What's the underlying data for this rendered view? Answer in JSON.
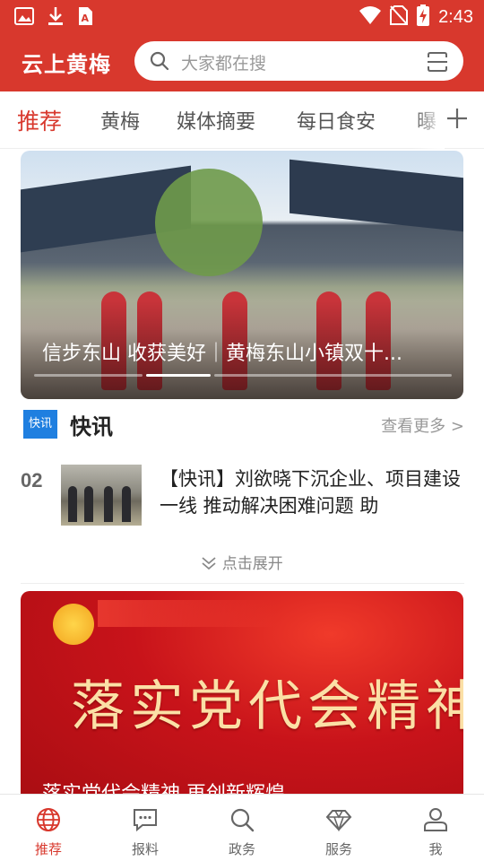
{
  "status_bar": {
    "time": "2:43",
    "left_icons": [
      "image-icon",
      "download-icon",
      "a-icon"
    ],
    "right_icons": [
      "wifi-icon",
      "no-sim-icon",
      "battery-charging-icon"
    ]
  },
  "header": {
    "app_title": "云上黄梅",
    "search_placeholder": "大家都在搜",
    "brand_color": "#d8382d"
  },
  "tabs": {
    "items": [
      {
        "label": "推荐",
        "active": true
      },
      {
        "label": "黄梅",
        "active": false
      },
      {
        "label": "媒体摘要",
        "active": false
      },
      {
        "label": "每日食安",
        "active": false
      },
      {
        "label": "曝",
        "active": false
      }
    ],
    "add_icon": "plus-icon"
  },
  "hero": {
    "caption": "信步东山 收获美好｜黄梅东山小镇双十...",
    "slide_count": 4,
    "active_slide": 2
  },
  "flash": {
    "badge": "快讯",
    "title": "快讯",
    "more": "查看更多 >",
    "item": {
      "number": "02",
      "text": "【快讯】刘欲晓下沉企业、项目建设一线  推动解决困难问题 助"
    },
    "expand_label": "点击展开"
  },
  "banner2": {
    "title": "落实党代会精神",
    "caption": "落实党代会精神 再创新辉煌"
  },
  "bottom_nav": {
    "items": [
      {
        "label": "推荐",
        "icon": "globe-icon",
        "active": true
      },
      {
        "label": "报料",
        "icon": "chat-icon",
        "active": false
      },
      {
        "label": "政务",
        "icon": "search-icon",
        "active": false
      },
      {
        "label": "服务",
        "icon": "diamond-icon",
        "active": false
      },
      {
        "label": "我",
        "icon": "user-icon",
        "active": false
      }
    ]
  }
}
